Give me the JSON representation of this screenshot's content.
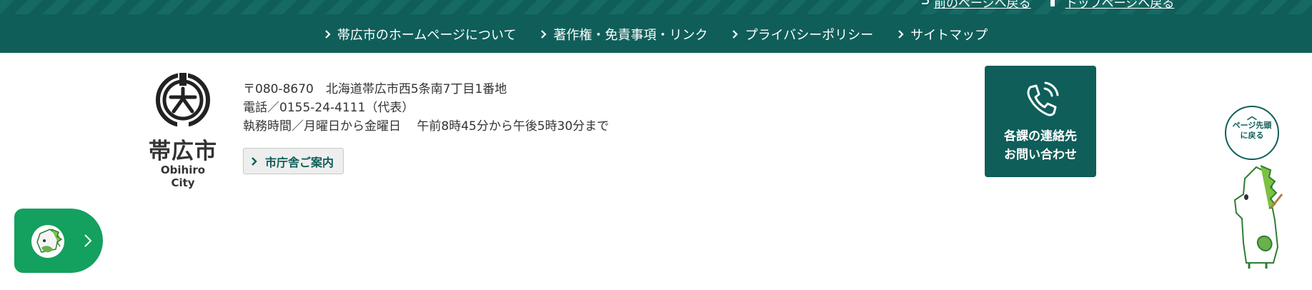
{
  "back_links": [
    {
      "label": "前のページへ戻る",
      "icon": "return-arrow-icon"
    },
    {
      "label": "トップページへ戻る",
      "icon": "home-square-icon"
    }
  ],
  "footer_nav": [
    {
      "label": "帯広市のホームページについて"
    },
    {
      "label": "著作権・免責事項・リンク"
    },
    {
      "label": "プライバシーポリシー"
    },
    {
      "label": "サイトマップ"
    }
  ],
  "city": {
    "name_ja": "帯広市",
    "name_en": "Obihiro City"
  },
  "address": {
    "postal_line": "〒080-8670　北海道帯広市西5条南7丁目1番地",
    "phone_line": "電話／0155-24-4111（代表）",
    "hours_line": "執務時間／月曜日から金曜日　 午前8時45分から午後5時30分まで"
  },
  "guide_button": {
    "label": "市庁舎ご案内"
  },
  "contact_button": {
    "line1": "各課の連絡先",
    "line2": "お問い合わせ"
  },
  "page_top": {
    "label": "ページ先頭に戻る",
    "arrow": "︿"
  },
  "colors": {
    "primary": "#0f5e59",
    "chat_green": "#14a05e"
  }
}
